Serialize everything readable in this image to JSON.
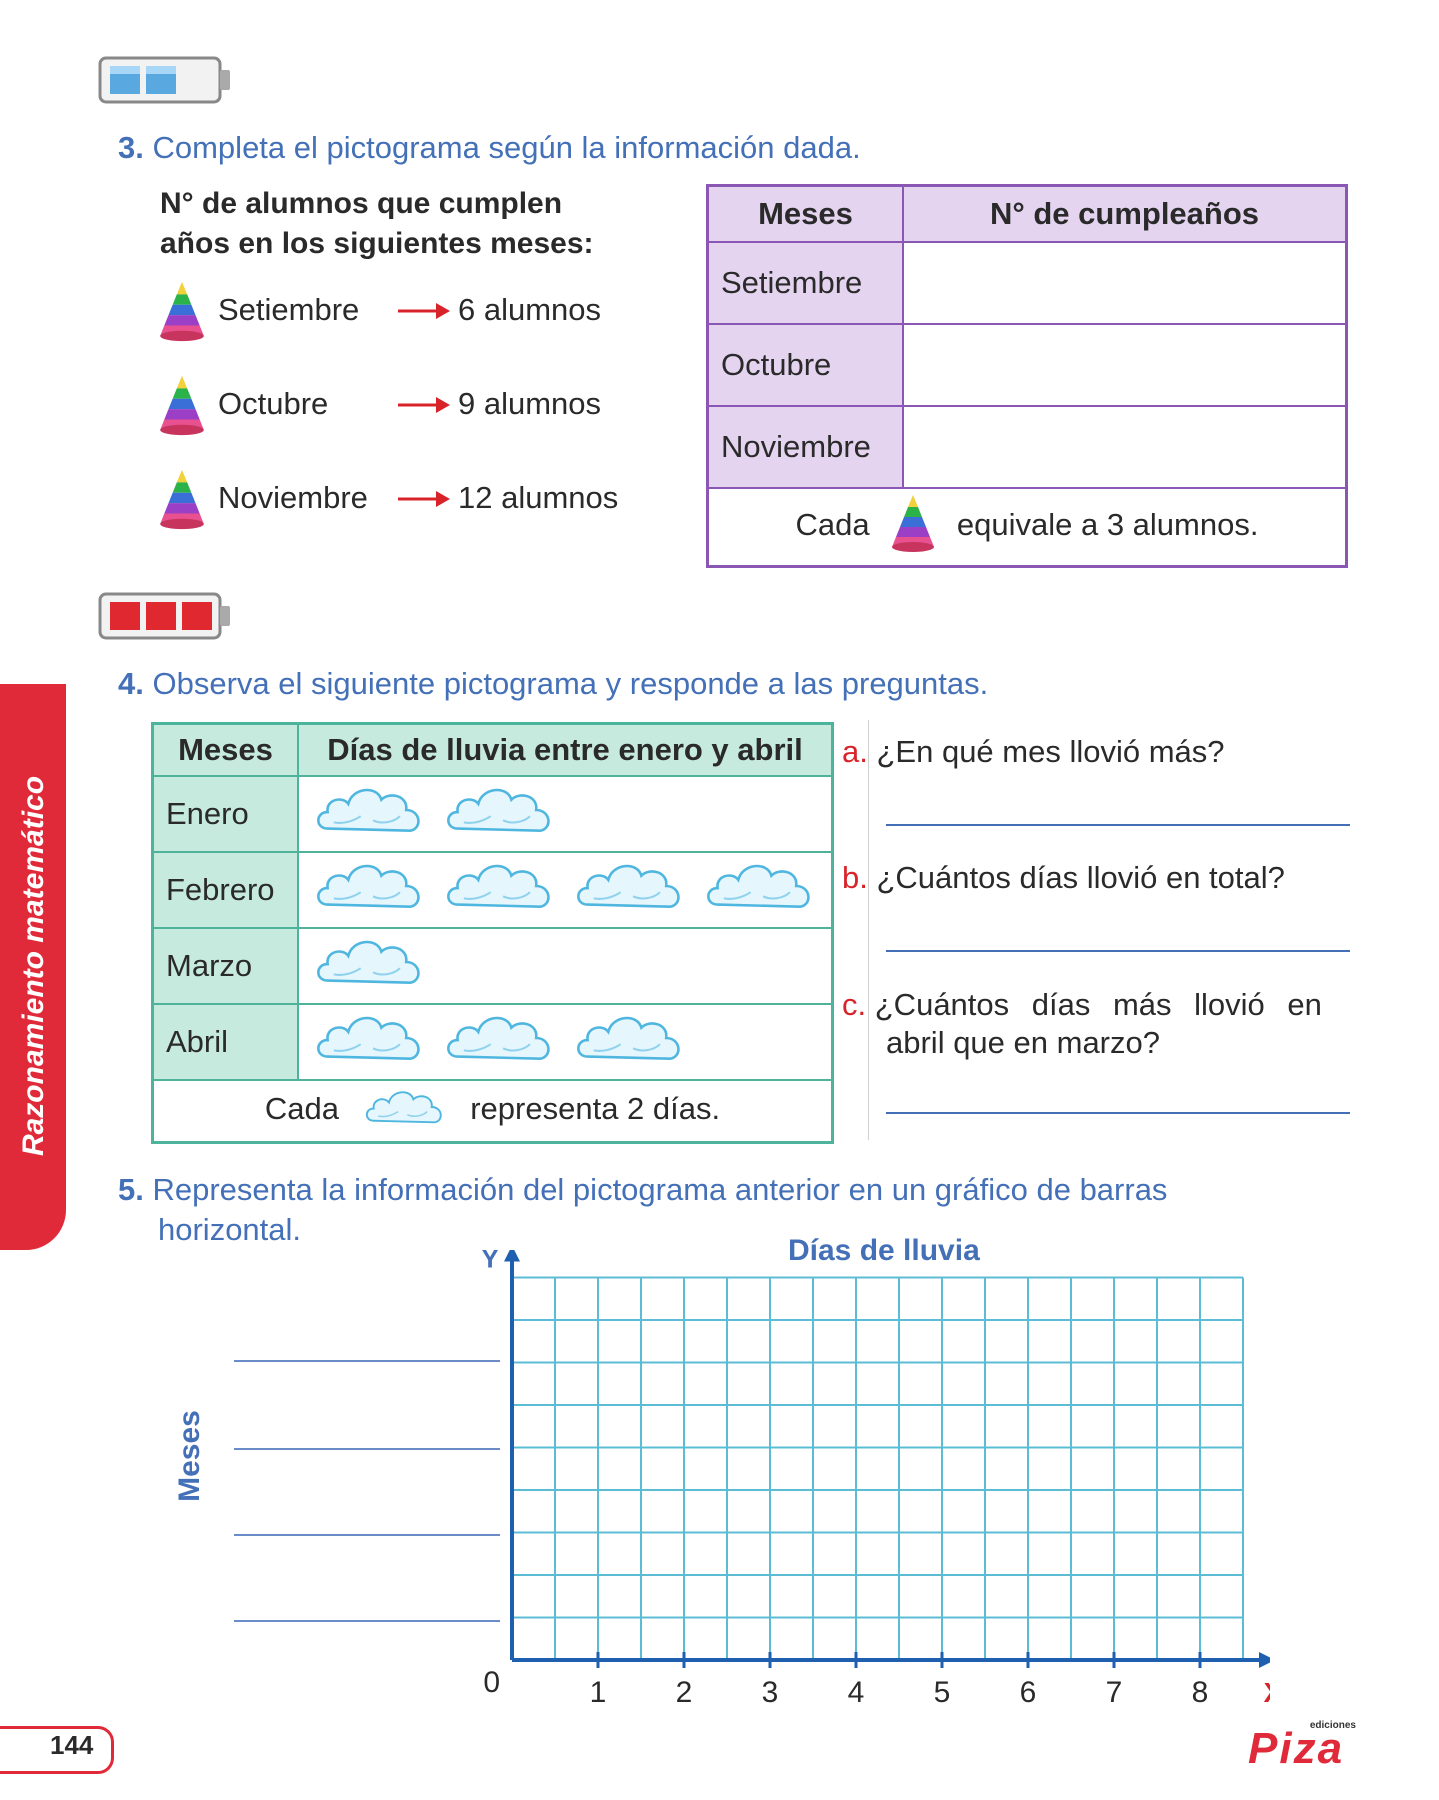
{
  "section3": {
    "number": "3.",
    "instruction": "Completa el pictograma según la información dada.",
    "subtitle_line1": "N° de alumnos que cumplen",
    "subtitle_line2": "años en los siguientes meses:",
    "items": [
      {
        "month": "Setiembre",
        "value": "6 alumnos"
      },
      {
        "month": "Octubre",
        "value": "9 alumnos"
      },
      {
        "month": "Noviembre",
        "value": "12 alumnos"
      }
    ],
    "table": {
      "header_month": "Meses",
      "header_count": "N° de cumpleaños",
      "rows": [
        "Setiembre",
        "Octubre",
        "Noviembre"
      ],
      "key_prefix": "Cada",
      "key_suffix": "equivale a 3 alumnos."
    }
  },
  "section4": {
    "number": "4.",
    "instruction": "Observa el siguiente pictograma y responde a las preguntas.",
    "table": {
      "header_month": "Meses",
      "header_days": "Días de lluvia entre enero y abril",
      "rows": [
        {
          "month": "Enero",
          "clouds": 2
        },
        {
          "month": "Febrero",
          "clouds": 4
        },
        {
          "month": "Marzo",
          "clouds": 1
        },
        {
          "month": "Abril",
          "clouds": 3
        }
      ],
      "key_prefix": "Cada",
      "key_suffix": "representa 2 días."
    },
    "questions": [
      {
        "letter": "a.",
        "text": "¿En qué mes llovió más?"
      },
      {
        "letter": "b.",
        "text": "¿Cuántos días llovió en total?"
      },
      {
        "letter": "c.",
        "text_line1": "¿Cuántos días más llovió en",
        "text_line2": "abril que en marzo?"
      }
    ]
  },
  "section5": {
    "number": "5.",
    "instruction_line1": "Representa la información del pictograma anterior en un gráfico de barras",
    "instruction_line2": "horizontal.",
    "chart_title": "Días de lluvia",
    "y_axis_letter": "Y",
    "x_axis_letter": "X",
    "y_label": "Meses",
    "origin": "0",
    "x_ticks": [
      "1",
      "2",
      "3",
      "4",
      "5",
      "6",
      "7",
      "8"
    ]
  },
  "side_tab": "Razonamiento matemático",
  "page_number": "144",
  "brand": {
    "small": "ediciones",
    "name": "Piza"
  },
  "colors": {
    "blue": "#4470b8",
    "red": "#d8232a",
    "purple": "#8a58b4",
    "green": "#4db39a",
    "grid": "#5bbcd6"
  }
}
